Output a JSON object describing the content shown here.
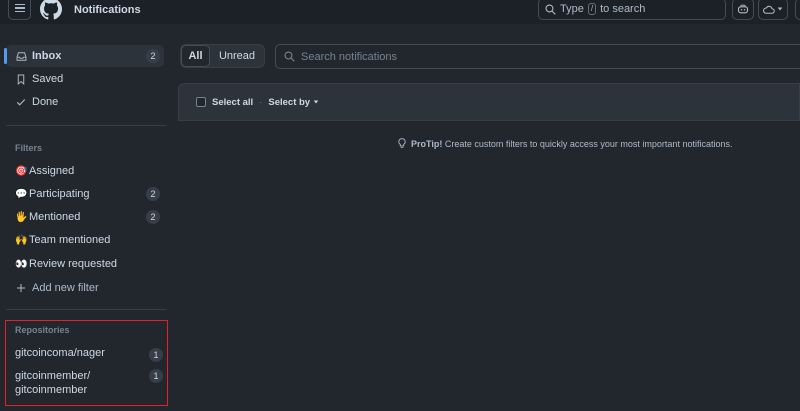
{
  "header": {
    "title": "Notifications",
    "search_prefix": "Type",
    "search_key": "/",
    "search_suffix": "to search"
  },
  "sidebar": {
    "main_items": [
      {
        "label": "Inbox",
        "count": "2",
        "icon": "inbox-icon"
      },
      {
        "label": "Saved",
        "count": "",
        "icon": "bookmark-icon"
      },
      {
        "label": "Done",
        "count": "",
        "icon": "check-icon"
      }
    ],
    "filters_title": "Filters",
    "filters": [
      {
        "emoji": "🎯",
        "label": "Assigned",
        "count": ""
      },
      {
        "emoji": "💬",
        "label": "Participating",
        "count": "2"
      },
      {
        "emoji": "🖐",
        "label": "Mentioned",
        "count": "2"
      },
      {
        "emoji": "🙌",
        "label": "Team mentioned",
        "count": ""
      },
      {
        "emoji": "👀",
        "label": "Review requested",
        "count": ""
      }
    ],
    "add_filter": "Add new filter",
    "repositories_title": "Repositories",
    "repositories": [
      {
        "name": "gitcoincoma/nager",
        "count": "1"
      },
      {
        "name_line1": "gitcoinmember/",
        "name_line2": "gitcoinmember",
        "count": "1"
      }
    ]
  },
  "main": {
    "tabs": [
      "All",
      "Unread"
    ],
    "search_placeholder": "Search notifications",
    "select_all": "Select all",
    "separator": "·",
    "select_by": "Select by",
    "protip_label": "ProTip!",
    "protip_text": "Create custom filters to quickly access your most important notifications."
  },
  "colors": {
    "background": "#22272e",
    "accent": "#539bf5",
    "highlight_box": "#e5202e"
  }
}
